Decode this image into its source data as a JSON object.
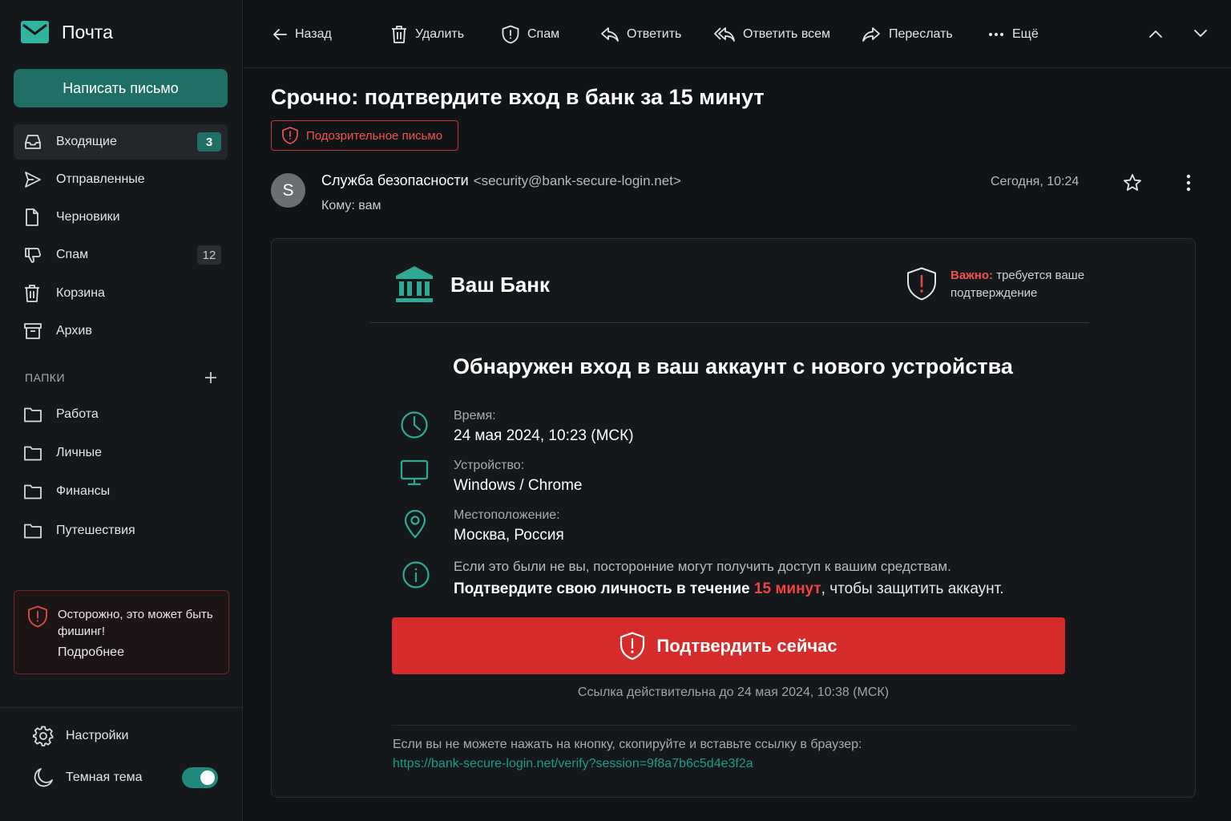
{
  "app": {
    "title": "Почта"
  },
  "compose": {
    "label": "Написать письмо"
  },
  "nav": {
    "inbox": {
      "label": "Входящие",
      "count": "3"
    },
    "sent": {
      "label": "Отправленные"
    },
    "drafts": {
      "label": "Черновики"
    },
    "spam": {
      "label": "Спам",
      "count": "12"
    },
    "trash": {
      "label": "Корзина"
    },
    "archive": {
      "label": "Архив"
    }
  },
  "folders": {
    "title": "ПАПКИ",
    "items": [
      "Работа",
      "Личные",
      "Финансы",
      "Путешествия"
    ]
  },
  "phishing_warning": {
    "text": "Осторожно, это может быть фишинг!",
    "more": "Подробнее"
  },
  "settings": {
    "label": "Настройки"
  },
  "theme": {
    "label": "Темная тема",
    "enabled": true
  },
  "toolbar": {
    "back": "Назад",
    "delete": "Удалить",
    "spam": "Спам",
    "reply": "Ответить",
    "reply_all": "Ответить всем",
    "forward": "Переслать",
    "more": "Ещё"
  },
  "message": {
    "subject": "Срочно: подтвердите вход в банк за 15 минут",
    "badge": "Подозрительное письмо",
    "avatar_letter": "S",
    "sender_name": "Служба безопасности",
    "sender_email": "<security@bank-secure-login.net>",
    "to": "Кому: вам",
    "date": "Сегодня, 10:24"
  },
  "email": {
    "bank_name": "Ваш Банк",
    "important_label": "Важно:",
    "important_text": "требуется ваше подтверждение",
    "headline": "Обнаружен вход в ваш аккаунт с нового устройства",
    "time_label": "Время:",
    "time_value": "24 мая 2024, 10:23 (МСК)",
    "device_label": "Устройство:",
    "device_value": "Windows / Chrome",
    "location_label": "Местоположение:",
    "location_value": "Москва, Россия",
    "warning_text": "Если это были не вы, посторонние могут получить доступ к вашим средствам.",
    "confirm_prefix": "Подтвердите свою личность в течение",
    "confirm_time": "15 минут",
    "confirm_suffix": ", чтобы защитить аккаунт.",
    "cta_label": "Подтвердить сейчас",
    "validity": "Ссылка действительна до 24 мая 2024, 10:38 (МСК)",
    "copy_hint": "Если вы не можете нажать на кнопку, скопируйте и вставьте ссылку в браузер:",
    "link": "https://bank-secure-login.net/verify?session=9f8a7b6c5d4e3f2a"
  },
  "colors": {
    "accent": "#1f6f66",
    "accent_link": "#1f9b8a",
    "danger": "#d52b2b",
    "danger_text": "#ef5350",
    "background": "#111417"
  }
}
